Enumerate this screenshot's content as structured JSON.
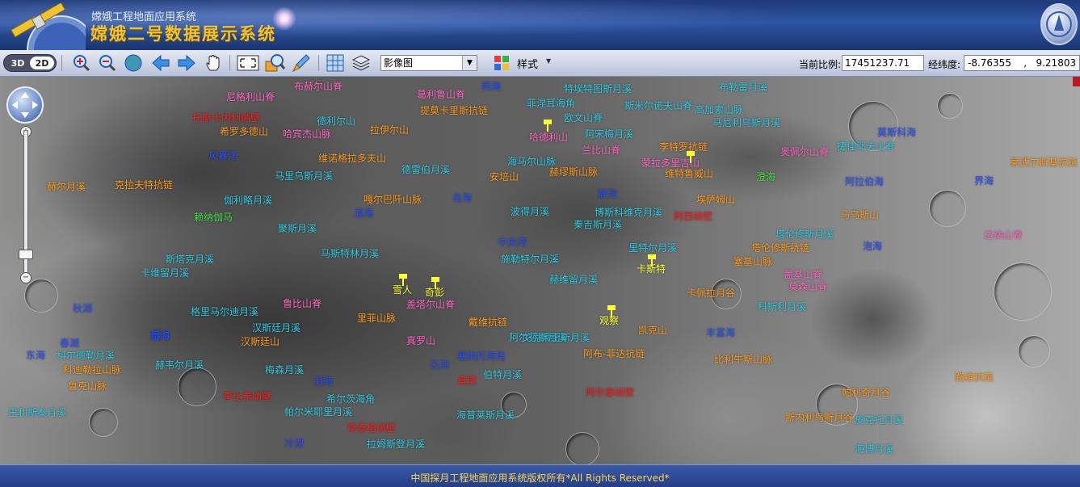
{
  "header": {
    "subtitle": "嫦娥工程地面应用系统",
    "title": "嫦娥二号数据展示系统"
  },
  "toolbar": {
    "mode_3d": "3D",
    "mode_2d": "2D",
    "active_mode": "2D",
    "tools": [
      "zoom-in-icon",
      "zoom-out-icon",
      "globe-icon",
      "back-arrow-icon",
      "forward-arrow-icon",
      "pan-hand-icon",
      "fullscreen-icon",
      "magnify-layer-icon",
      "eraser-icon",
      "grid-icon",
      "layers-icon",
      "style-icon"
    ],
    "layer_select": "影像图",
    "style_label": "样式",
    "scale_label": "当前比例:",
    "scale_value": "17451237.71",
    "coord_label": "经纬度:",
    "coord_value": "-8.76355    ,   9.21803"
  },
  "map": {
    "labels": [
      {
        "text": "布赫尔山脊",
        "color": "pink"
      },
      {
        "text": "尼格利山脊",
        "color": "pink"
      },
      {
        "text": "葛利鲁山脊",
        "color": "pink"
      },
      {
        "text": "雨海",
        "color": "blue"
      },
      {
        "text": "特埃特图斯月溪",
        "color": "cyan"
      },
      {
        "text": "斯米尔诺夫山脊",
        "color": "cyan"
      },
      {
        "text": "布勒雷月溪",
        "color": "cyan"
      },
      {
        "text": "托斯卡内利峭壁",
        "color": "red"
      },
      {
        "text": "希罗多德山",
        "color": "orange"
      },
      {
        "text": "德利尔山",
        "color": "cyan"
      },
      {
        "text": "哈宾杰山脉",
        "color": "pink"
      },
      {
        "text": "拉伊尔山",
        "color": "orange"
      },
      {
        "text": "提莫卡里斯抗链",
        "color": "orange"
      },
      {
        "text": "欧文山脊",
        "color": "cyan"
      },
      {
        "text": "菲涅耳海角",
        "color": "cyan"
      },
      {
        "text": "哈德利山",
        "color": "pink"
      },
      {
        "text": "阿宋梅月溪",
        "color": "cyan"
      },
      {
        "text": "高加索山脉",
        "color": "cyan"
      },
      {
        "text": "马尼利乌斯月溪",
        "color": "cyan"
      },
      {
        "text": "维诺格拉多夫山",
        "color": "orange"
      },
      {
        "text": "德雷伯月溪",
        "color": "cyan"
      },
      {
        "text": "安培山",
        "color": "orange"
      },
      {
        "text": "海马尔山脉",
        "color": "cyan"
      },
      {
        "text": "兰比山脊",
        "color": "pink"
      },
      {
        "text": "李特罗抗链",
        "color": "orange"
      },
      {
        "text": "莫斯科海",
        "color": "blue"
      },
      {
        "text": "捷佳耶夫山脊",
        "color": "cyan"
      },
      {
        "text": "奥佩尔山脊",
        "color": "pink"
      },
      {
        "text": "阿拉伯海",
        "color": "blue"
      },
      {
        "text": "风暴洋",
        "color": "blue"
      },
      {
        "text": "马里乌斯月溪",
        "color": "cyan"
      },
      {
        "text": "赫缪斯山脉",
        "color": "orange"
      },
      {
        "text": "维特鲁威山",
        "color": "orange"
      },
      {
        "text": "蒙拉多里吉山",
        "color": "pink"
      },
      {
        "text": "界海",
        "color": "blue"
      },
      {
        "text": "莱武尔斯基抗链",
        "color": "orange"
      },
      {
        "text": "赫尔月溪",
        "color": "orange"
      },
      {
        "text": "克拉夫特抗链",
        "color": "orange"
      },
      {
        "text": "伽利略月溪",
        "color": "cyan"
      },
      {
        "text": "嘎尔巴阡山脉",
        "color": "orange"
      },
      {
        "text": "岛海",
        "color": "blue"
      },
      {
        "text": "波得月溪",
        "color": "cyan"
      },
      {
        "text": "静海",
        "color": "blue"
      },
      {
        "text": "埃萨姆山",
        "color": "orange"
      },
      {
        "text": "湿海",
        "color": "blue"
      },
      {
        "text": "澄海",
        "color": "green"
      },
      {
        "text": "赖纳伽马",
        "color": "green"
      },
      {
        "text": "博斯科维克月溪",
        "color": "cyan"
      },
      {
        "text": "阿西峭壁",
        "color": "red"
      },
      {
        "text": "秦吉斯月溪",
        "color": "cyan"
      },
      {
        "text": "马乌斯山",
        "color": "orange"
      },
      {
        "text": "聚斯月溪",
        "color": "cyan"
      },
      {
        "text": "中央湾",
        "color": "blue"
      },
      {
        "text": "里特尔月溪",
        "color": "cyan"
      },
      {
        "text": "塔伦修斯月溪",
        "color": "cyan"
      },
      {
        "text": "达纳山脊",
        "color": "pink"
      },
      {
        "text": "马斯特林月溪",
        "color": "cyan"
      },
      {
        "text": "施勒特尔月溪",
        "color": "cyan"
      },
      {
        "text": "泡海",
        "color": "blue"
      },
      {
        "text": "塔伦修斯抗链",
        "color": "orange"
      },
      {
        "text": "塞基山脉",
        "color": "orange"
      },
      {
        "text": "卡维留月溪",
        "color": "cyan"
      },
      {
        "text": "斯塔克月溪",
        "color": "cyan"
      },
      {
        "text": "卡斯特",
        "color": "yellow"
      },
      {
        "text": "盖基山脊",
        "color": "pink"
      },
      {
        "text": "莫森山脊",
        "color": "pink"
      },
      {
        "text": "卡佩拉月谷",
        "color": "orange"
      },
      {
        "text": "赫维留月溪",
        "color": "cyan"
      },
      {
        "text": "科斯利月溪",
        "color": "cyan"
      },
      {
        "text": "雪人",
        "color": "yellow"
      },
      {
        "text": "奇彭",
        "color": "yellow"
      },
      {
        "text": "盖塔尔山脊",
        "color": "pink"
      },
      {
        "text": "鲁比山脊",
        "color": "pink"
      },
      {
        "text": "秋湖",
        "color": "blue"
      },
      {
        "text": "格里马尔迪月溪",
        "color": "cyan"
      },
      {
        "text": "里菲山脉",
        "color": "orange"
      },
      {
        "text": "戴维抗链",
        "color": "orange"
      },
      {
        "text": "观察",
        "color": "yellow"
      },
      {
        "text": "凯克山",
        "color": "orange"
      },
      {
        "text": "戈克莱纽斯月溪",
        "color": "cyan"
      },
      {
        "text": "夏湖",
        "color": "blue"
      },
      {
        "text": "汉斯廷月溪",
        "color": "cyan"
      },
      {
        "text": "汉斯廷山",
        "color": "orange"
      },
      {
        "text": "阿尔芬斯月溪",
        "color": "cyan"
      },
      {
        "text": "真罗山",
        "color": "pink"
      },
      {
        "text": "丰富海",
        "color": "blue"
      },
      {
        "text": "阿布-菲达抗链",
        "color": "orange"
      },
      {
        "text": "春湖",
        "color": "blue"
      },
      {
        "text": "比利牛斯山脉",
        "color": "orange"
      },
      {
        "text": "东海",
        "color": "blue"
      },
      {
        "text": "科尔德勒月溪",
        "color": "cyan"
      },
      {
        "text": "科迪勒拉山脉",
        "color": "orange"
      },
      {
        "text": "鲁克山脉",
        "color": "orange"
      },
      {
        "text": "赫韦尔月溪",
        "color": "cyan"
      },
      {
        "text": "梅森月溪",
        "color": "cyan"
      },
      {
        "text": "云海",
        "color": "blue"
      },
      {
        "text": "塞纳托海角",
        "color": "blue"
      },
      {
        "text": "直壁",
        "color": "red"
      },
      {
        "text": "伯特月溪",
        "color": "cyan"
      },
      {
        "text": "泪海",
        "color": "blue"
      },
      {
        "text": "帕利奇月谷",
        "color": "orange"
      },
      {
        "text": "湿海",
        "color": "blue"
      },
      {
        "text": "路维抗链",
        "color": "orange"
      },
      {
        "text": "李比希峭壁",
        "color": "red"
      },
      {
        "text": "希尔茨海角",
        "color": "cyan"
      },
      {
        "text": "阿尔泰峭壁",
        "color": "red"
      },
      {
        "text": "帕尔米耶里月溪",
        "color": "cyan"
      },
      {
        "text": "海普莱斯月溪",
        "color": "cyan"
      },
      {
        "text": "巴利斯泰月溪",
        "color": "cyan"
      },
      {
        "text": "斯泰格峭壁",
        "color": "red"
      },
      {
        "text": "冷湖",
        "color": "blue"
      },
      {
        "text": "拉姆斯登月溪",
        "color": "cyan"
      },
      {
        "text": "斯内利乌斯月谷",
        "color": "orange"
      },
      {
        "text": "皮克托月溪",
        "color": "cyan"
      },
      {
        "text": "海博月溪",
        "color": "cyan"
      }
    ]
  },
  "nav": {
    "zoom_in": "+",
    "zoom_out": "−"
  },
  "footer": {
    "copyright": "中国探月工程地面应用系统版权所有*All Rights Reserved*"
  }
}
